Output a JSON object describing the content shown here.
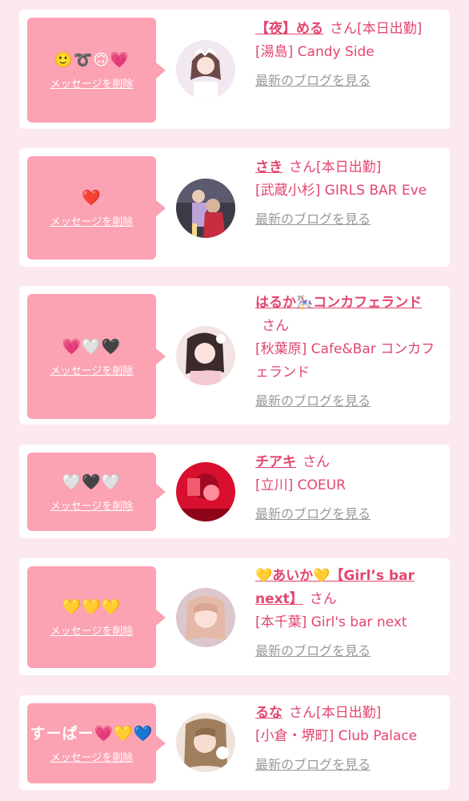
{
  "items": [
    {
      "message": "🙂➰🙃💗",
      "delete_label": "メッセージを削除",
      "name": "【夜】める",
      "honorific": "さん",
      "status": "[本日出勤]",
      "shop": "[湯島] Candy Side",
      "blog_label": "最新のブログを見る"
    },
    {
      "message": "❤️",
      "delete_label": "メッセージを削除",
      "name": "さき",
      "honorific": "さん",
      "status": "[本日出勤]",
      "shop": "[武蔵小杉] GIRLS BAR Eve",
      "blog_label": "最新のブログを見る"
    },
    {
      "message": "💗🤍🖤",
      "delete_label": "メッセージを削除",
      "name": "はるか🎠コンカフェランド",
      "honorific": "さん",
      "status": "",
      "shop": "[秋葉原] Cafe&Bar コンカフェランド",
      "blog_label": "最新のブログを見る"
    },
    {
      "message": "🤍🖤🤍",
      "delete_label": "メッセージを削除",
      "name": "チアキ",
      "honorific": "さん",
      "status": "",
      "shop": "[立川] COEUR",
      "blog_label": "最新のブログを見る"
    },
    {
      "message": "💛💛💛",
      "delete_label": "メッセージを削除",
      "name": "💛あいか💛【Girl’s bar next】",
      "honorific": "さん",
      "status": "",
      "shop": "[本千葉] Girl's bar next",
      "blog_label": "最新のブログを見る"
    },
    {
      "message": "すーぱー💗💛💙",
      "delete_label": "メッセージを削除",
      "name": "るな",
      "honorific": "さん",
      "status": "[本日出勤]",
      "shop": "[小倉・堺町] Club Palace",
      "blog_label": "最新のブログを見る"
    }
  ],
  "colors": {
    "background": "#fce9ee",
    "card": "#ffffff",
    "message_box": "#fba2b3",
    "accent": "#e2466f",
    "muted": "#999999"
  }
}
